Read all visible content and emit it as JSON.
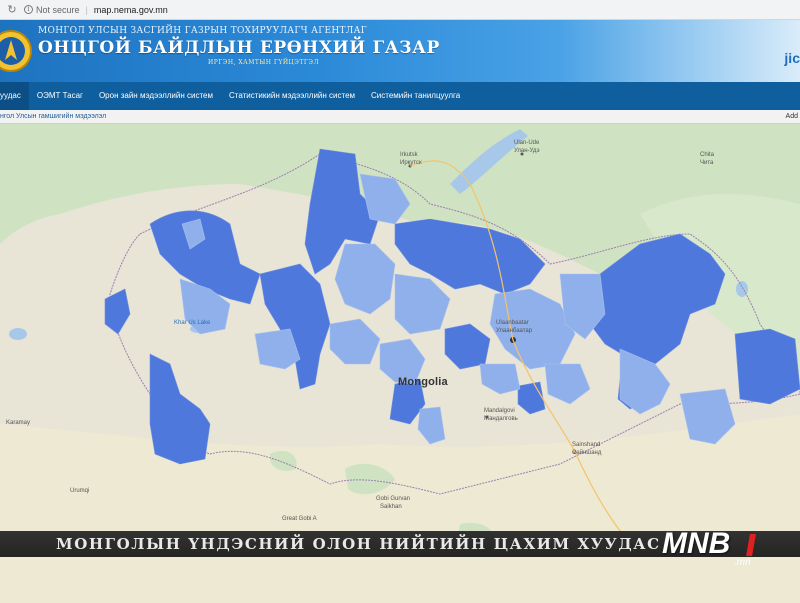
{
  "browser": {
    "security_label": "Not secure",
    "url": "map.nema.gov.mn"
  },
  "header": {
    "line1": "МОНГОЛ УЛСЫН ЗАСГИЙН ГАЗРЫН ТОХИРУУЛАГЧ АГЕНТЛАГ",
    "line2": "ОНЦГОЙ БАЙДЛЫН ЕРӨНХИЙ ГАЗАР",
    "line3": "ИРГЭН, ХАМТЫН ГҮЙЦЭТГЭЛ",
    "right_logo": "jic"
  },
  "nav": {
    "items": [
      {
        "label": "уудас"
      },
      {
        "label": "ОЭМТ Тасаг"
      },
      {
        "label": "Орон зайн мэдээллийн систем"
      },
      {
        "label": "Статистикийн мэдээллийн систем"
      },
      {
        "label": "Системийн танилцуулга"
      }
    ]
  },
  "subbar": {
    "breadcrumb": "нгол Улсын гамшигийн мэдээлэл",
    "add_label": "Add"
  },
  "map": {
    "country_label": "Mongolia",
    "labels": [
      {
        "text": "Ulaanbaatar"
      },
      {
        "text": "Улаанбаатар"
      },
      {
        "text": "Irkutsk"
      },
      {
        "text": "Иркутск"
      },
      {
        "text": "Ulan-Ude"
      },
      {
        "text": "Улан-Удэ"
      },
      {
        "text": "Khar Us Lake"
      },
      {
        "text": "Gobi Gurvan"
      },
      {
        "text": "Saikhan"
      },
      {
        "text": "Great Gobi A"
      },
      {
        "text": "Mandalgovi"
      },
      {
        "text": "Мандалговь"
      },
      {
        "text": "Sainshand"
      },
      {
        "text": "Сайншанд"
      },
      {
        "text": "Karamay"
      },
      {
        "text": "Urumqi"
      },
      {
        "text": "Chita"
      },
      {
        "text": "Чита"
      }
    ],
    "colors": {
      "base_land": "#ebe7d7",
      "forest": "#cfe3c2",
      "water": "#a8c8ea",
      "region_dark": "#4f78dc",
      "region_light": "#8fb0ea"
    }
  },
  "overlay": {
    "ticker": "МОНГОЛЫН ҮНДЭСНИЙ ОЛОН НИЙТИЙН ЦАХИМ ХУУДАС",
    "channel": "MNB",
    "channel_sub": ".mn"
  }
}
